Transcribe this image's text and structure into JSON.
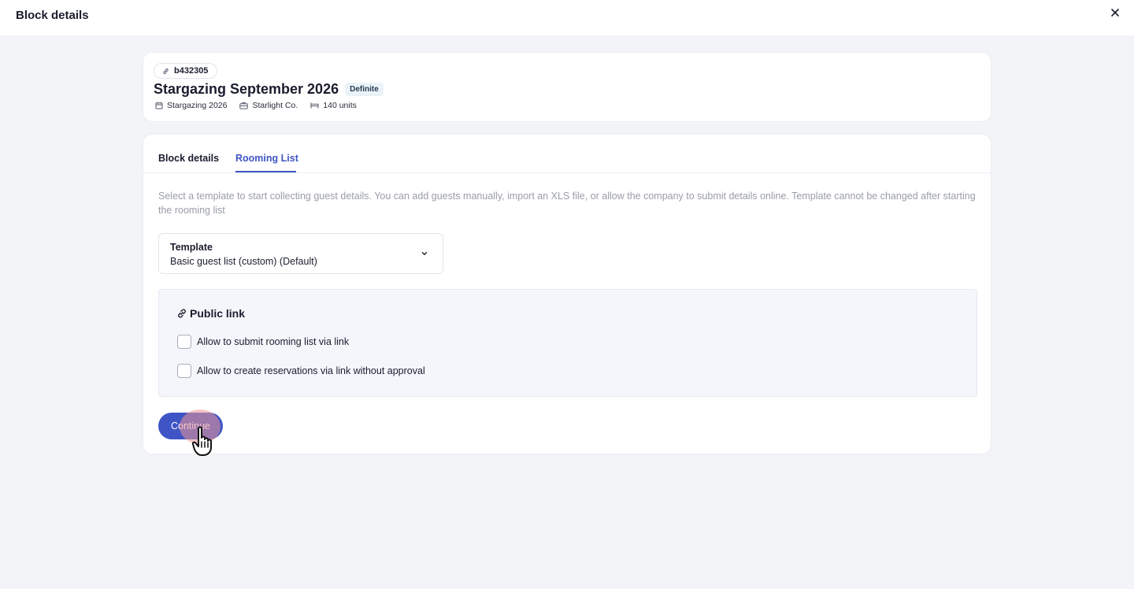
{
  "window": {
    "title": "Block details",
    "close_icon": "close-icon"
  },
  "block": {
    "code": "b432305",
    "title": "Stargazing September 2026",
    "status": "Definite",
    "meta": {
      "event": "Stargazing 2026",
      "company": "Starlight Co.",
      "units": "140 units"
    }
  },
  "tabs": [
    {
      "label": "Block details",
      "active": false
    },
    {
      "label": "Rooming List",
      "active": true
    }
  ],
  "rooming": {
    "description": "Select a template to start collecting guest details. You can add guests manually, import an XLS file, or allow the company to submit details online. Template cannot be changed after starting the rooming list",
    "template": {
      "label": "Template",
      "value": "Basic guest list (custom) (Default)"
    },
    "public_link": {
      "title": "Public link",
      "options": [
        {
          "label": "Allow to submit rooming list via link",
          "checked": false
        },
        {
          "label": "Allow to create reservations via link without approval",
          "checked": false
        }
      ]
    },
    "continue_label": "Continue"
  },
  "colors": {
    "accent": "#3f55c6",
    "background": "#f3f4f7",
    "panel": "#f5f6fc"
  }
}
